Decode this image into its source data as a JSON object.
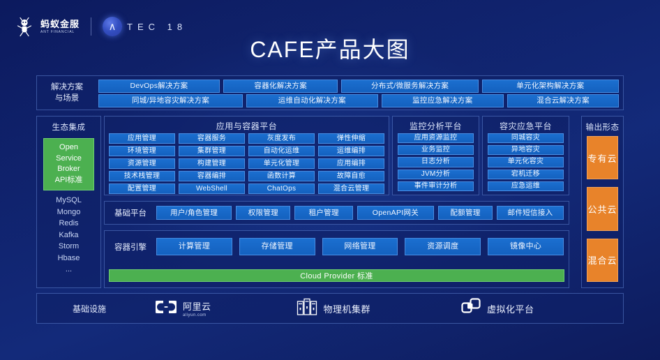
{
  "brand": {
    "ant_cn": "蚂蚁金服",
    "ant_en": "ANT FINANCIAL",
    "atec_mark": "∧",
    "atec_word": "TEC 18"
  },
  "title": "CAFE产品大图",
  "solutions": {
    "label_line1": "解决方案",
    "label_line2": "与场景",
    "row1": [
      "DevOps解决方案",
      "容器化解决方案",
      "分布式/微服务解决方案",
      "单元化架构解决方案"
    ],
    "row2": [
      "同城/异地容灾解决方案",
      "运维自动化解决方案",
      "监控应急解决方案",
      "混合云解决方案"
    ]
  },
  "ecosystem": {
    "title": "生态集成",
    "green": [
      "Open",
      "Service",
      "Broker",
      "API标准"
    ],
    "items": [
      "MySQL",
      "Mongo",
      "Redis",
      "Kafka",
      "Storm",
      "Hbase",
      "..."
    ]
  },
  "app_container": {
    "title": "应用与容器平台",
    "items": [
      "应用管理",
      "容器服务",
      "灰度发布",
      "弹性伸缩",
      "环境管理",
      "集群管理",
      "自动化运维",
      "运维编排",
      "资源管理",
      "构建管理",
      "单元化管理",
      "应用编排",
      "技术栈管理",
      "容器编排",
      "函数计算",
      "故障自愈",
      "配置管理",
      "WebShell",
      "ChatOps",
      "混合云管理"
    ]
  },
  "monitor": {
    "title": "监控分析平台",
    "items": [
      "应用资源监控",
      "业务监控",
      "日志分析",
      "JVM分析",
      "事件审计分析"
    ]
  },
  "disaster_recovery": {
    "title": "容灾应急平台",
    "items": [
      "同城容灾",
      "异地容灾",
      "单元化容灾",
      "宕机迁移",
      "应急运维"
    ]
  },
  "output": {
    "title": "输出形态",
    "items": [
      "专有云",
      "公共云",
      "混合云"
    ],
    "color": "#e8832a"
  },
  "base_platform": {
    "label": "基础平台",
    "items": [
      "用户/角色管理",
      "权限管理",
      "租户管理",
      "OpenAPI网关",
      "配额管理",
      "邮件短信接入"
    ]
  },
  "container_engine": {
    "label": "容器引擎",
    "items": [
      "计算管理",
      "存储管理",
      "网络管理",
      "资源调度",
      "镜像中心"
    ],
    "cloud_provider_bar": "Cloud Provider 标准",
    "bar_color": "#4cb050"
  },
  "infrastructure": {
    "label": "基础设施",
    "items": [
      {
        "name": "阿里云",
        "sub": "aliyun.com",
        "icon": "aliyun-icon"
      },
      {
        "name": "物理机集群",
        "sub": "",
        "icon": "server-rack-icon"
      },
      {
        "name": "虚拟化平台",
        "sub": "",
        "icon": "vmware-icon"
      }
    ]
  },
  "colors": {
    "chip_blue": "#1668c4",
    "panel_bg": "#0e2068",
    "accent_green": "#4cb050",
    "accent_orange": "#e8832a"
  }
}
